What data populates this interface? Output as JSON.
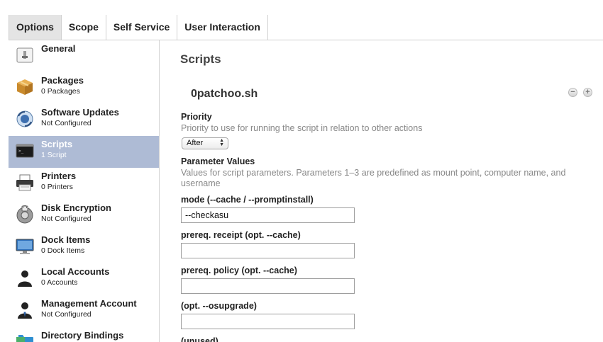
{
  "tabs": [
    {
      "label": "Options",
      "active": true
    },
    {
      "label": "Scope",
      "active": false
    },
    {
      "label": "Self Service",
      "active": false
    },
    {
      "label": "User Interaction",
      "active": false
    }
  ],
  "sidebar": {
    "items": [
      {
        "label": "General",
        "sub": "",
        "icon": "general-icon"
      },
      {
        "label": "Packages",
        "sub": "0 Packages",
        "icon": "package-icon"
      },
      {
        "label": "Software Updates",
        "sub": "Not Configured",
        "icon": "software-update-icon"
      },
      {
        "label": "Scripts",
        "sub": "1 Script",
        "icon": "terminal-icon",
        "selected": true
      },
      {
        "label": "Printers",
        "sub": "0 Printers",
        "icon": "printer-icon"
      },
      {
        "label": "Disk Encryption",
        "sub": "Not Configured",
        "icon": "disk-encryption-icon"
      },
      {
        "label": "Dock Items",
        "sub": "0 Dock Items",
        "icon": "monitor-icon"
      },
      {
        "label": "Local Accounts",
        "sub": "0 Accounts",
        "icon": "user-icon"
      },
      {
        "label": "Management Account",
        "sub": "Not Configured",
        "icon": "admin-user-icon"
      },
      {
        "label": "Directory Bindings",
        "sub": "",
        "icon": "directory-icon"
      }
    ]
  },
  "main": {
    "section_title": "Scripts",
    "script_name": "0patchoo.sh",
    "remove_symbol": "−",
    "add_symbol": "+",
    "priority": {
      "label": "Priority",
      "desc": "Priority to use for running the script in relation to other actions",
      "value": "After"
    },
    "parameters": {
      "label": "Parameter Values",
      "desc": "Values for script parameters. Parameters 1–3 are predefined as mount point, computer name, and username"
    },
    "fields": [
      {
        "label": "mode (--cache / --promptinstall)",
        "value": "--checkasu"
      },
      {
        "label": "prereq. receipt (opt. --cache)",
        "value": ""
      },
      {
        "label": "prereq. policy (opt. --cache)",
        "value": ""
      },
      {
        "label": "(opt. --osupgrade)",
        "value": ""
      },
      {
        "label": "(unused)",
        "value": ""
      }
    ]
  },
  "colors": {
    "selected_row": "#aebbd5",
    "active_tab": "#e4e4e4"
  }
}
